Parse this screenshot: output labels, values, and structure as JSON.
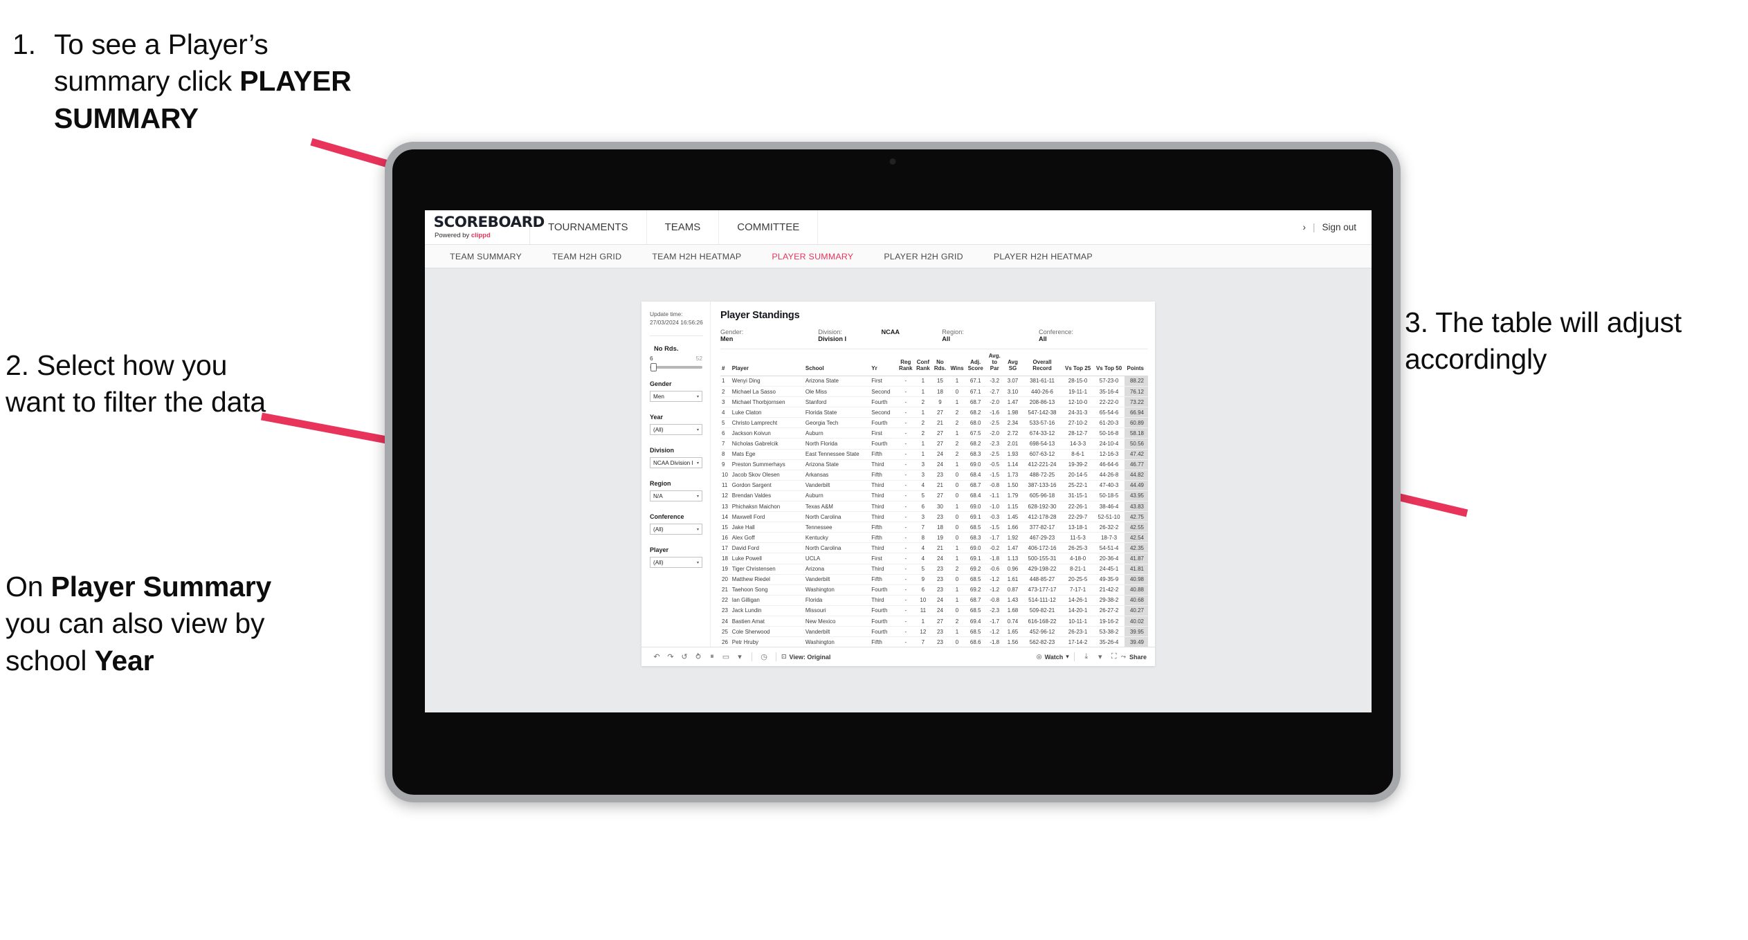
{
  "annotations": {
    "a1_num": "1.",
    "a1_text_pre": "To see a Player’s summary click ",
    "a1_bold": "PLAYER SUMMARY",
    "a2": "2. Select how you want to filter the data",
    "a3_pre": "On ",
    "a3_bold1": "Player Summary",
    "a3_mid": " you can also view by school ",
    "a3_bold2": "Year",
    "a4": "3. The table will adjust accordingly",
    "accent_pink": "#e8335a"
  },
  "app": {
    "brand_name": "SCOREBOARD",
    "brand_sub_pre": "Powered by ",
    "brand_sub_link": "clippd",
    "main_nav": [
      "TOURNAMENTS",
      "TEAMS",
      "COMMITTEE"
    ],
    "account_chevron": "›",
    "separator": "|",
    "sign_out": "Sign out",
    "tabs": [
      {
        "label": "TEAM SUMMARY",
        "active": false
      },
      {
        "label": "TEAM H2H GRID",
        "active": false
      },
      {
        "label": "TEAM H2H HEATMAP",
        "active": false
      },
      {
        "label": "PLAYER SUMMARY",
        "active": true
      },
      {
        "label": "PLAYER H2H GRID",
        "active": false
      },
      {
        "label": "PLAYER H2H HEATMAP",
        "active": false
      }
    ]
  },
  "filters": {
    "update_label": "Update time:",
    "update_value": "27/03/2024 16:56:26",
    "no_rds_label": "No Rds.",
    "no_rds_min": "6",
    "no_rds_max": "52",
    "groups": [
      {
        "label": "Gender",
        "value": "Men"
      },
      {
        "label": "Year",
        "value": "(All)"
      },
      {
        "label": "Division",
        "value": "NCAA Division I"
      },
      {
        "label": "Region",
        "value": "N/A"
      },
      {
        "label": "Conference",
        "value": "(All)"
      },
      {
        "label": "Player",
        "value": "(All)"
      }
    ]
  },
  "report": {
    "title": "Player Standings",
    "summary": [
      {
        "label": "Gender:",
        "value": "Men"
      },
      {
        "label": "Division:",
        "value": "NCAA Division I"
      },
      {
        "label": "Region:",
        "value": "All"
      },
      {
        "label": "Conference:",
        "value": "All"
      }
    ]
  },
  "table": {
    "headers": {
      "num": "#",
      "player": "Player",
      "school": "School",
      "yr": "Yr",
      "reg_rank_l1": "Reg",
      "reg_rank_l2": "Rank",
      "conf_rank_l1": "Conf",
      "conf_rank_l2": "Rank",
      "no_rds_l1": "No",
      "no_rds_l2": "Rds.",
      "wins": "Wins",
      "adj_l1": "Adj.",
      "adj_l2": "Score",
      "atp_l1": "Avg.",
      "atp_l2": "to Par",
      "sg_l1": "Avg",
      "sg_l2": "SG",
      "rec_l1": "Overall",
      "rec_l2": "Record",
      "t25": "Vs Top 25",
      "t50": "Vs Top 50",
      "points": "Points"
    },
    "rows": [
      {
        "num": "1",
        "player": "Wenyi Ding",
        "school": "Arizona State",
        "yr": "First",
        "reg": "-",
        "conf": "1",
        "rds": "15",
        "wins": "1",
        "adj": "67.1",
        "atp": "-3.2",
        "sg": "3.07",
        "rec": "381-61-11",
        "t25": "28-15-0",
        "t50": "57-23-0",
        "pts": "88.22"
      },
      {
        "num": "2",
        "player": "Michael La Sasso",
        "school": "Ole Miss",
        "yr": "Second",
        "reg": "-",
        "conf": "1",
        "rds": "18",
        "wins": "0",
        "adj": "67.1",
        "atp": "-2.7",
        "sg": "3.10",
        "rec": "440-26-6",
        "t25": "19-11-1",
        "t50": "35-16-4",
        "pts": "76.12"
      },
      {
        "num": "3",
        "player": "Michael Thorbjornsen",
        "school": "Stanford",
        "yr": "Fourth",
        "reg": "-",
        "conf": "2",
        "rds": "9",
        "wins": "1",
        "adj": "68.7",
        "atp": "-2.0",
        "sg": "1.47",
        "rec": "208-86-13",
        "t25": "12-10-0",
        "t50": "22-22-0",
        "pts": "73.22"
      },
      {
        "num": "4",
        "player": "Luke Claton",
        "school": "Florida State",
        "yr": "Second",
        "reg": "-",
        "conf": "1",
        "rds": "27",
        "wins": "2",
        "adj": "68.2",
        "atp": "-1.6",
        "sg": "1.98",
        "rec": "547-142-38",
        "t25": "24-31-3",
        "t50": "65-54-6",
        "pts": "66.94"
      },
      {
        "num": "5",
        "player": "Christo Lamprecht",
        "school": "Georgia Tech",
        "yr": "Fourth",
        "reg": "-",
        "conf": "2",
        "rds": "21",
        "wins": "2",
        "adj": "68.0",
        "atp": "-2.5",
        "sg": "2.34",
        "rec": "533-57-16",
        "t25": "27-10-2",
        "t50": "61-20-3",
        "pts": "60.89"
      },
      {
        "num": "6",
        "player": "Jackson Koivun",
        "school": "Auburn",
        "yr": "First",
        "reg": "-",
        "conf": "2",
        "rds": "27",
        "wins": "1",
        "adj": "67.5",
        "atp": "-2.0",
        "sg": "2.72",
        "rec": "674-33-12",
        "t25": "28-12-7",
        "t50": "50-16-8",
        "pts": "58.18"
      },
      {
        "num": "7",
        "player": "Nicholas Gabrelcik",
        "school": "North Florida",
        "yr": "Fourth",
        "reg": "-",
        "conf": "1",
        "rds": "27",
        "wins": "2",
        "adj": "68.2",
        "atp": "-2.3",
        "sg": "2.01",
        "rec": "698-54-13",
        "t25": "14-3-3",
        "t50": "24-10-4",
        "pts": "50.56"
      },
      {
        "num": "8",
        "player": "Mats Ege",
        "school": "East Tennessee State",
        "yr": "Fifth",
        "reg": "-",
        "conf": "1",
        "rds": "24",
        "wins": "2",
        "adj": "68.3",
        "atp": "-2.5",
        "sg": "1.93",
        "rec": "607-63-12",
        "t25": "8-6-1",
        "t50": "12-16-3",
        "pts": "47.42"
      },
      {
        "num": "9",
        "player": "Preston Summerhays",
        "school": "Arizona State",
        "yr": "Third",
        "reg": "-",
        "conf": "3",
        "rds": "24",
        "wins": "1",
        "adj": "69.0",
        "atp": "-0.5",
        "sg": "1.14",
        "rec": "412-221-24",
        "t25": "19-39-2",
        "t50": "46-64-6",
        "pts": "46.77"
      },
      {
        "num": "10",
        "player": "Jacob Skov Olesen",
        "school": "Arkansas",
        "yr": "Fifth",
        "reg": "-",
        "conf": "3",
        "rds": "23",
        "wins": "0",
        "adj": "68.4",
        "atp": "-1.5",
        "sg": "1.73",
        "rec": "488-72-25",
        "t25": "20-14-5",
        "t50": "44-26-8",
        "pts": "44.82"
      },
      {
        "num": "11",
        "player": "Gordon Sargent",
        "school": "Vanderbilt",
        "yr": "Third",
        "reg": "-",
        "conf": "4",
        "rds": "21",
        "wins": "0",
        "adj": "68.7",
        "atp": "-0.8",
        "sg": "1.50",
        "rec": "387-133-16",
        "t25": "25-22-1",
        "t50": "47-40-3",
        "pts": "44.49"
      },
      {
        "num": "12",
        "player": "Brendan Valdes",
        "school": "Auburn",
        "yr": "Third",
        "reg": "-",
        "conf": "5",
        "rds": "27",
        "wins": "0",
        "adj": "68.4",
        "atp": "-1.1",
        "sg": "1.79",
        "rec": "605-96-18",
        "t25": "31-15-1",
        "t50": "50-18-5",
        "pts": "43.95"
      },
      {
        "num": "13",
        "player": "Phichaksn Maichon",
        "school": "Texas A&M",
        "yr": "Third",
        "reg": "-",
        "conf": "6",
        "rds": "30",
        "wins": "1",
        "adj": "69.0",
        "atp": "-1.0",
        "sg": "1.15",
        "rec": "628-192-30",
        "t25": "22-26-1",
        "t50": "38-46-4",
        "pts": "43.83"
      },
      {
        "num": "14",
        "player": "Maxwell Ford",
        "school": "North Carolina",
        "yr": "Third",
        "reg": "-",
        "conf": "3",
        "rds": "23",
        "wins": "0",
        "adj": "69.1",
        "atp": "-0.3",
        "sg": "1.45",
        "rec": "412-178-28",
        "t25": "22-29-7",
        "t50": "52-51-10",
        "pts": "42.75"
      },
      {
        "num": "15",
        "player": "Jake Hall",
        "school": "Tennessee",
        "yr": "Fifth",
        "reg": "-",
        "conf": "7",
        "rds": "18",
        "wins": "0",
        "adj": "68.5",
        "atp": "-1.5",
        "sg": "1.66",
        "rec": "377-82-17",
        "t25": "13-18-1",
        "t50": "26-32-2",
        "pts": "42.55"
      },
      {
        "num": "16",
        "player": "Alex Goff",
        "school": "Kentucky",
        "yr": "Fifth",
        "reg": "-",
        "conf": "8",
        "rds": "19",
        "wins": "0",
        "adj": "68.3",
        "atp": "-1.7",
        "sg": "1.92",
        "rec": "467-29-23",
        "t25": "11-5-3",
        "t50": "18-7-3",
        "pts": "42.54"
      },
      {
        "num": "17",
        "player": "David Ford",
        "school": "North Carolina",
        "yr": "Third",
        "reg": "-",
        "conf": "4",
        "rds": "21",
        "wins": "1",
        "adj": "69.0",
        "atp": "-0.2",
        "sg": "1.47",
        "rec": "406-172-16",
        "t25": "26-25-3",
        "t50": "54-51-4",
        "pts": "42.35"
      },
      {
        "num": "18",
        "player": "Luke Powell",
        "school": "UCLA",
        "yr": "First",
        "reg": "-",
        "conf": "4",
        "rds": "24",
        "wins": "1",
        "adj": "69.1",
        "atp": "-1.8",
        "sg": "1.13",
        "rec": "500-155-31",
        "t25": "4-18-0",
        "t50": "20-36-4",
        "pts": "41.87"
      },
      {
        "num": "19",
        "player": "Tiger Christensen",
        "school": "Arizona",
        "yr": "Third",
        "reg": "-",
        "conf": "5",
        "rds": "23",
        "wins": "2",
        "adj": "69.2",
        "atp": "-0.6",
        "sg": "0.96",
        "rec": "429-198-22",
        "t25": "8-21-1",
        "t50": "24-45-1",
        "pts": "41.81"
      },
      {
        "num": "20",
        "player": "Matthew Riedel",
        "school": "Vanderbilt",
        "yr": "Fifth",
        "reg": "-",
        "conf": "9",
        "rds": "23",
        "wins": "0",
        "adj": "68.5",
        "atp": "-1.2",
        "sg": "1.61",
        "rec": "448-85-27",
        "t25": "20-25-5",
        "t50": "49-35-9",
        "pts": "40.98"
      },
      {
        "num": "21",
        "player": "Taehoon Song",
        "school": "Washington",
        "yr": "Fourth",
        "reg": "-",
        "conf": "6",
        "rds": "23",
        "wins": "1",
        "adj": "69.2",
        "atp": "-1.2",
        "sg": "0.87",
        "rec": "473-177-17",
        "t25": "7-17-1",
        "t50": "21-42-2",
        "pts": "40.88"
      },
      {
        "num": "22",
        "player": "Ian Gilligan",
        "school": "Florida",
        "yr": "Third",
        "reg": "-",
        "conf": "10",
        "rds": "24",
        "wins": "1",
        "adj": "68.7",
        "atp": "-0.8",
        "sg": "1.43",
        "rec": "514-111-12",
        "t25": "14-26-1",
        "t50": "29-38-2",
        "pts": "40.68"
      },
      {
        "num": "23",
        "player": "Jack Lundin",
        "school": "Missouri",
        "yr": "Fourth",
        "reg": "-",
        "conf": "11",
        "rds": "24",
        "wins": "0",
        "adj": "68.5",
        "atp": "-2.3",
        "sg": "1.68",
        "rec": "509-82-21",
        "t25": "14-20-1",
        "t50": "26-27-2",
        "pts": "40.27"
      },
      {
        "num": "24",
        "player": "Bastien Amat",
        "school": "New Mexico",
        "yr": "Fourth",
        "reg": "-",
        "conf": "1",
        "rds": "27",
        "wins": "2",
        "adj": "69.4",
        "atp": "-1.7",
        "sg": "0.74",
        "rec": "616-168-22",
        "t25": "10-11-1",
        "t50": "19-16-2",
        "pts": "40.02"
      },
      {
        "num": "25",
        "player": "Cole Sherwood",
        "school": "Vanderbilt",
        "yr": "Fourth",
        "reg": "-",
        "conf": "12",
        "rds": "23",
        "wins": "1",
        "adj": "68.5",
        "atp": "-1.2",
        "sg": "1.65",
        "rec": "452-96-12",
        "t25": "26-23-1",
        "t50": "53-38-2",
        "pts": "39.95"
      },
      {
        "num": "26",
        "player": "Petr Hruby",
        "school": "Washington",
        "yr": "Fifth",
        "reg": "-",
        "conf": "7",
        "rds": "23",
        "wins": "0",
        "adj": "68.6",
        "atp": "-1.8",
        "sg": "1.56",
        "rec": "562-82-23",
        "t25": "17-14-2",
        "t50": "35-26-4",
        "pts": "39.49"
      }
    ]
  },
  "toolbar": {
    "undo": "↶",
    "redo": "↷",
    "revert": "↺",
    "refresh": "⥁",
    "pause": "⏸",
    "rect": "▭",
    "caret": "▾",
    "clock": "◷",
    "view_label": "View: ",
    "view_value": "Original",
    "watch": "Watch",
    "watch_caret": "▾",
    "download_caret": "▾",
    "fullscreen": "⛶",
    "share": "Share"
  }
}
